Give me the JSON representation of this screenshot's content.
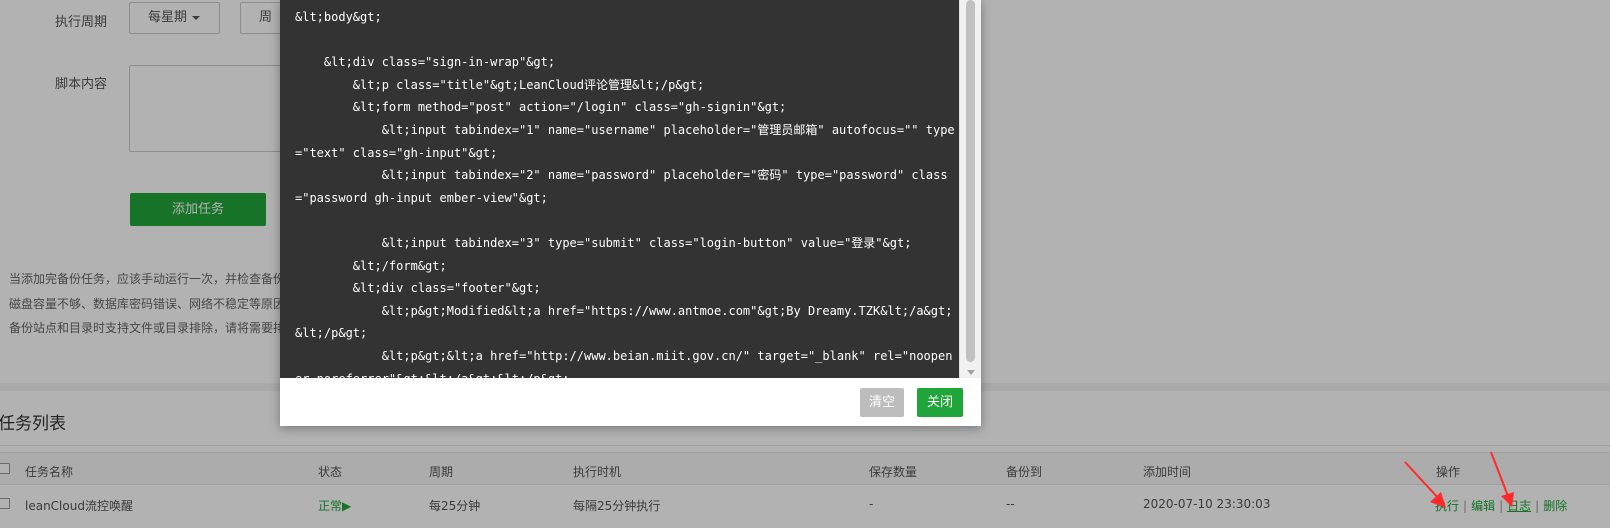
{
  "form": {
    "period_label": "执行周期",
    "period_value": "每星期",
    "period2_value": "周",
    "script_label": "脚本内容",
    "add_button": "添加任务"
  },
  "tips": [
    "当添加完备份任务，应该手动运行一次，并检查备份",
    "磁盘容量不够、数据库密码错误、网络不稳定等原因",
    "备份站点和目录时支持文件或目录排除，请将需要排"
  ],
  "task_list": {
    "title": "任务列表",
    "headers": [
      "任务名称",
      "状态",
      "周期",
      "执行时机",
      "保存数量",
      "备份到",
      "添加时间",
      "操作"
    ],
    "rows": [
      {
        "name": "leanCloud流控唤醒",
        "status": "正常▶",
        "period": "每25分钟",
        "timing": "每隔25分钟执行",
        "keep": "-",
        "backup_to": "--",
        "added": "2020-07-10 23:30:03",
        "ops": [
          "执行",
          "编辑",
          "日志",
          "删除"
        ]
      }
    ]
  },
  "modal": {
    "code_lines": [
      "&lt;body&gt;",
      "",
      "    &lt;div class=\"sign-in-wrap\"&gt;",
      "        &lt;p class=\"title\"&gt;LeanCloud评论管理&lt;/p&gt;",
      "        &lt;form method=\"post\" action=\"/login\" class=\"gh-signin\"&gt;",
      "            &lt;input tabindex=\"1\" name=\"username\" placeholder=\"管理员邮箱\" autofocus=\"\" type=\"text\" class=\"gh-input\"&gt;",
      "            &lt;input tabindex=\"2\" name=\"password\" placeholder=\"密码\" type=\"password\" class=\"password gh-input ember-view\"&gt;",
      "",
      "            &lt;input tabindex=\"3\" type=\"submit\" class=\"login-button\" value=\"登录\"&gt;",
      "        &lt;/form&gt;",
      "        &lt;div class=\"footer\"&gt;",
      "            &lt;p&gt;Modified&lt;a href=\"https://www.antmoe.com\"&gt;By Dreamy.TZK&lt;/a&gt;&lt;/p&gt;",
      "            &lt;p&gt;&lt;a href=\"http://www.beian.miit.gov.cn/\" target=\"_blank\" rel=\"noopener noreferrer\"&gt;&lt;/a&gt;&lt;/p&gt;"
    ],
    "clear_button": "清空",
    "close_button": "关闭"
  },
  "colors": {
    "accent_green": "#20a53a",
    "code_bg": "#333333",
    "arrow_red": "#ff2a2a"
  }
}
